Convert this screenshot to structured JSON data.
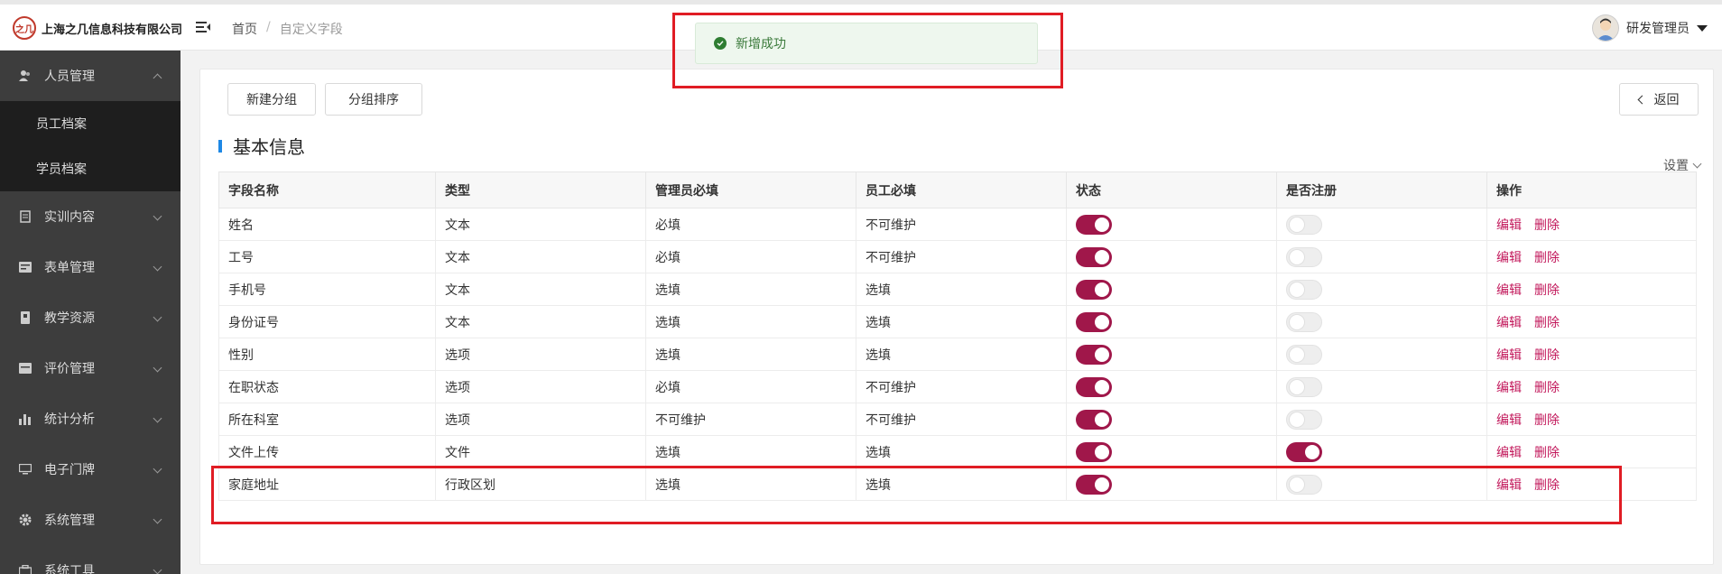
{
  "header": {
    "logo_mark": "之几",
    "company": "上海之几信息科技有限公司",
    "breadcrumb": [
      "首页",
      "自定义字段"
    ],
    "breadcrumb_sep": "/",
    "user_name": "研发管理员"
  },
  "sidebar": {
    "items": [
      {
        "label": "人员管理",
        "icon": "user-icon",
        "expanded": true
      },
      {
        "label": "实训内容",
        "icon": "doc-icon"
      },
      {
        "label": "表单管理",
        "icon": "form-icon"
      },
      {
        "label": "教学资源",
        "icon": "book-icon"
      },
      {
        "label": "评价管理",
        "icon": "rate-icon"
      },
      {
        "label": "统计分析",
        "icon": "chart-icon"
      },
      {
        "label": "电子门牌",
        "icon": "monitor-icon"
      },
      {
        "label": "系统管理",
        "icon": "gear-icon"
      },
      {
        "label": "系统工具",
        "icon": "tool-icon"
      }
    ],
    "sub_items": [
      "员工档案",
      "学员档案"
    ]
  },
  "toolbar": {
    "new_group": "新建分组",
    "group_sort": "分组排序",
    "back": "返回"
  },
  "section": {
    "title": "基本信息",
    "settings": "设置"
  },
  "table": {
    "headers": [
      "字段名称",
      "类型",
      "管理员必填",
      "员工必填",
      "状态",
      "是否注册",
      "操作"
    ],
    "rows": [
      {
        "name": "姓名",
        "type": "文本",
        "admin": "必填",
        "staff": "不可维护",
        "status": true,
        "register": false
      },
      {
        "name": "工号",
        "type": "文本",
        "admin": "必填",
        "staff": "不可维护",
        "status": true,
        "register": false
      },
      {
        "name": "手机号",
        "type": "文本",
        "admin": "选填",
        "staff": "选填",
        "status": true,
        "register": false
      },
      {
        "name": "身份证号",
        "type": "文本",
        "admin": "选填",
        "staff": "选填",
        "status": true,
        "register": false
      },
      {
        "name": "性别",
        "type": "选项",
        "admin": "选填",
        "staff": "选填",
        "status": true,
        "register": false
      },
      {
        "name": "在职状态",
        "type": "选项",
        "admin": "必填",
        "staff": "不可维护",
        "status": true,
        "register": false
      },
      {
        "name": "所在科室",
        "type": "选项",
        "admin": "不可维护",
        "staff": "不可维护",
        "status": true,
        "register": false
      },
      {
        "name": "文件上传",
        "type": "文件",
        "admin": "选填",
        "staff": "选填",
        "status": true,
        "register": true
      },
      {
        "name": "家庭地址",
        "type": "行政区划",
        "admin": "选填",
        "staff": "选填",
        "status": true,
        "register": false
      }
    ],
    "edit_label": "编辑",
    "delete_label": "删除"
  },
  "toast": {
    "message": "新增成功"
  },
  "colors": {
    "accent": "#a0174a",
    "link": "#c2185b",
    "sidebar_bg": "#3d3d3d",
    "highlight": "#e01c24"
  }
}
